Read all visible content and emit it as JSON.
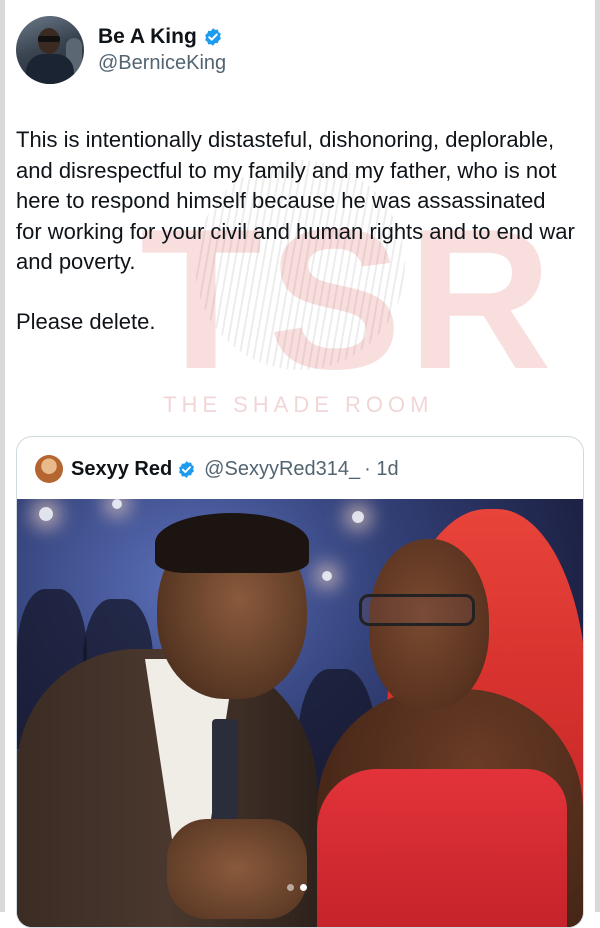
{
  "tweet": {
    "author": {
      "display_name": "Be A King",
      "handle": "@BerniceKing",
      "verified": true,
      "avatar_icon": "profile-photo"
    },
    "paragraphs": [
      "This is intentionally distasteful, dishonoring, deplorable, and disrespectful to my family and my father, who is not here to respond himself because he was assassinated for working for your civil and human rights and to end war and poverty.",
      "Please delete."
    ]
  },
  "watermark": {
    "letters": "TSR",
    "text": "THE SHADE ROOM"
  },
  "quoted_tweet": {
    "display_name": "Sexyy Red",
    "handle": "@SexyyRed314_",
    "time": "· 1d",
    "verified": true,
    "media_icon": "photo",
    "carousel": {
      "count": 2,
      "active": 2
    }
  },
  "colors": {
    "verified_blue": "#1d9bf0",
    "secondary_text": "#536471",
    "border": "#cfd9de"
  }
}
